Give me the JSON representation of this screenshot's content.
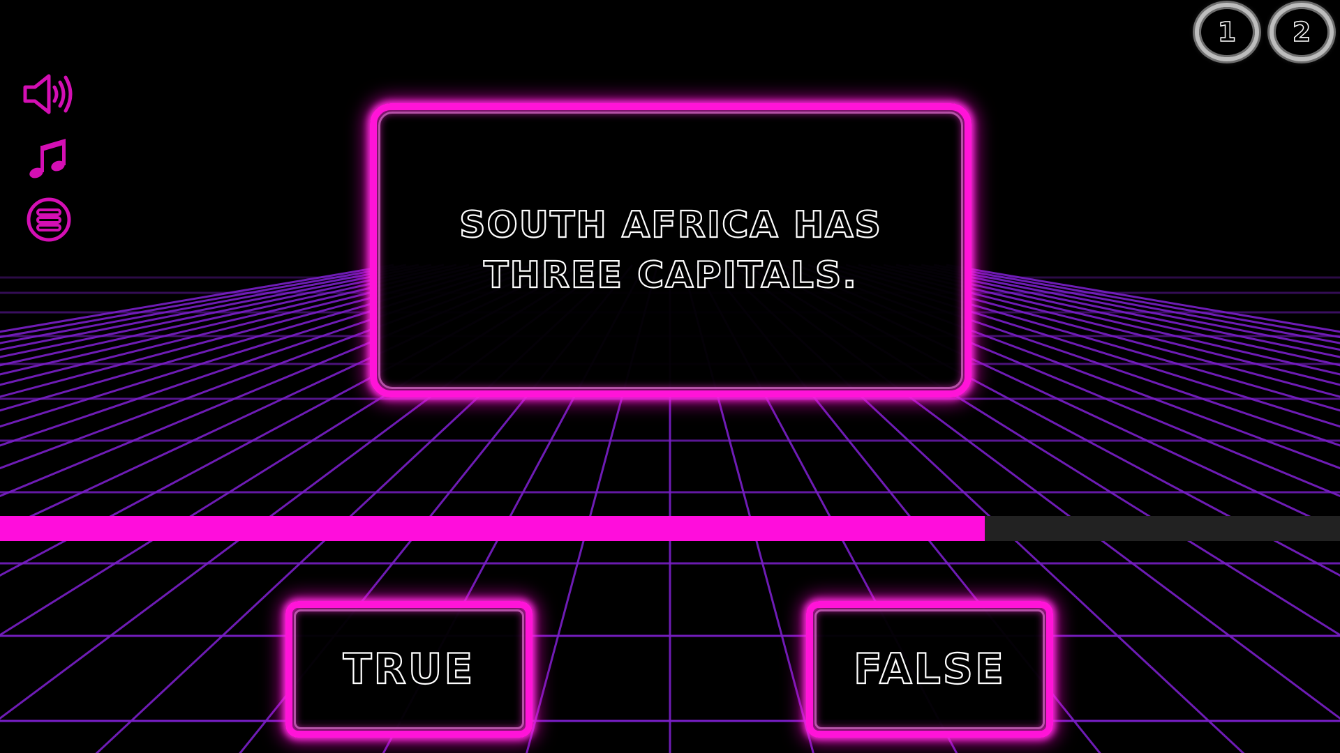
{
  "question": {
    "text": "South Africa has three capitals."
  },
  "answers": {
    "true_label": "TRUE",
    "false_label": "FALSE"
  },
  "players": [
    {
      "label": "1"
    },
    {
      "label": "2"
    }
  ],
  "timer": {
    "progress": 0.735
  },
  "sidebar": {
    "icons": [
      "speaker-icon",
      "music-note-icon",
      "menu-icon"
    ]
  },
  "colors": {
    "neon_pink": "#ff14d8",
    "grid_purple": "#7a1fc9",
    "timer_fill": "#ff0ddc",
    "timer_track": "#222222",
    "badge_ring": "#bdbdbd"
  }
}
